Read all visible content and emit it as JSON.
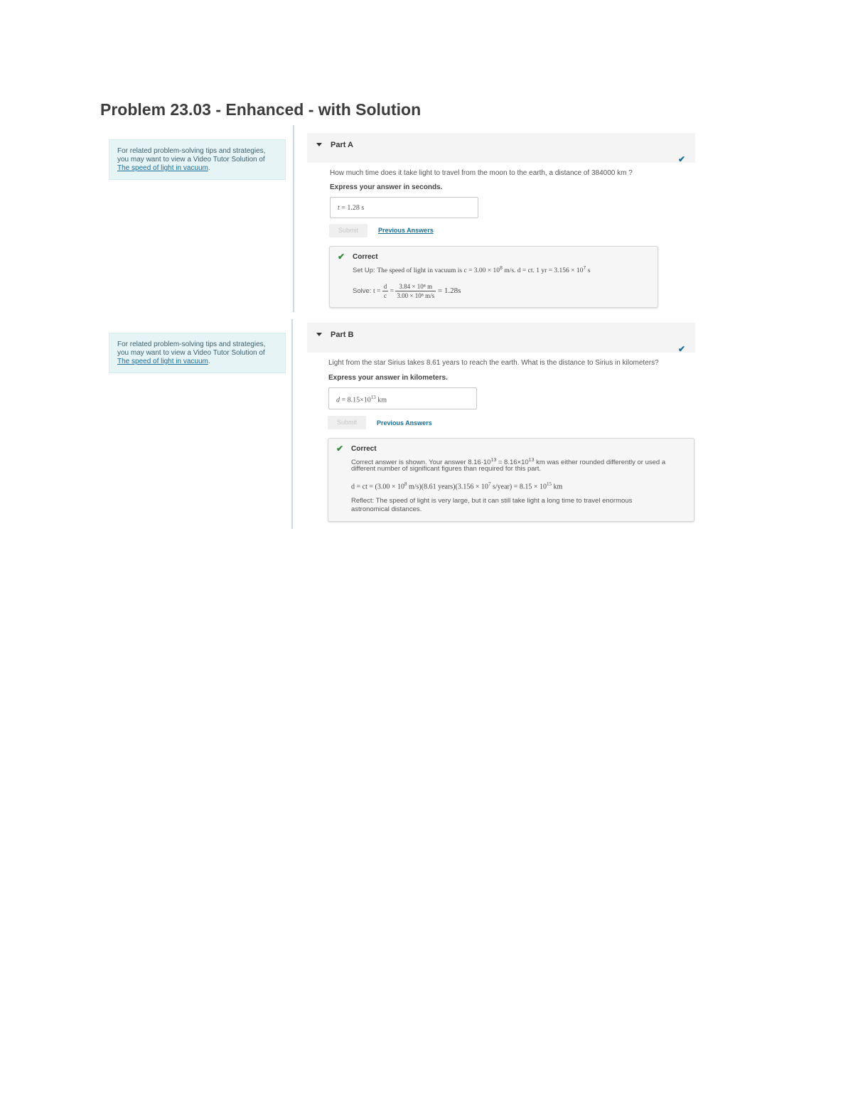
{
  "page": {
    "title": "Problem 23.03 - Enhanced - with Solution"
  },
  "tip": {
    "text": "For related problem-solving tips and strategies, you may want to view a Video Tutor Solution of ",
    "link": "The speed of light in vacuum",
    "end": "."
  },
  "part_a": {
    "label": "Part A",
    "question": "How much time does it take light to travel from the moon to the earth, a distance of 384000 km ?",
    "instruction": "Express your answer in seconds.",
    "answer_var": "t",
    "answer_eq": " = ",
    "answer_value": "1.28",
    "answer_unit": "s",
    "submit": "Submit",
    "previous": "Previous Answers",
    "feedback": {
      "title": "Correct",
      "setup_label": "Set Up: ",
      "setup_text": "The speed of light in vacuum is c = 3.00 × 10",
      "setup_exp": "8",
      "setup_rest": " m/s. d = ct. 1 yr = 3.156 × 10",
      "setup_exp2": "7",
      "setup_end": " s",
      "solve_label": "Solve: ",
      "solve_lhs": "t = ",
      "solve_frac1_num": "d",
      "solve_frac1_den": "c",
      "solve_eq": " = ",
      "solve_frac2_num": "3.84 × 10⁸ m",
      "solve_frac2_den": "3.00 × 10⁸ m/s",
      "solve_result": " = 1.28s"
    }
  },
  "part_b": {
    "label": "Part B",
    "question": "Light from the star Sirius takes 8.61 years to reach the earth. What is the distance to Sirius in kilometers?",
    "instruction": "Express your answer in kilometers.",
    "answer_var": "d",
    "answer_eq": " = ",
    "answer_value": "8.15×10",
    "answer_exp": "13",
    "answer_unit": "km",
    "submit": "Submit",
    "previous": "Previous Answers",
    "feedback": {
      "title": "Correct",
      "line1": "Correct answer is shown. Your answer 8.16·10",
      "line1_exp": "13",
      "line1_mid": " = 8.16×10",
      "line1_exp2": "13",
      "line1_end": " km was either rounded differently or used a",
      "line2": "different number of significant figures than required for this part.",
      "eq_a": "d = ct = (3.00 × 10",
      "eq_exp1": "8",
      "eq_b": " m/s)(8.61 years)(3.156 × 10",
      "eq_exp2": "7",
      "eq_c": " s/year) = 8.15 × 10",
      "eq_exp3": "15",
      "eq_d": " km",
      "reflect1": "Reflect: The speed of light is very large, but it can still take light a long time to travel enormous",
      "reflect2": "astronomical distances."
    }
  }
}
